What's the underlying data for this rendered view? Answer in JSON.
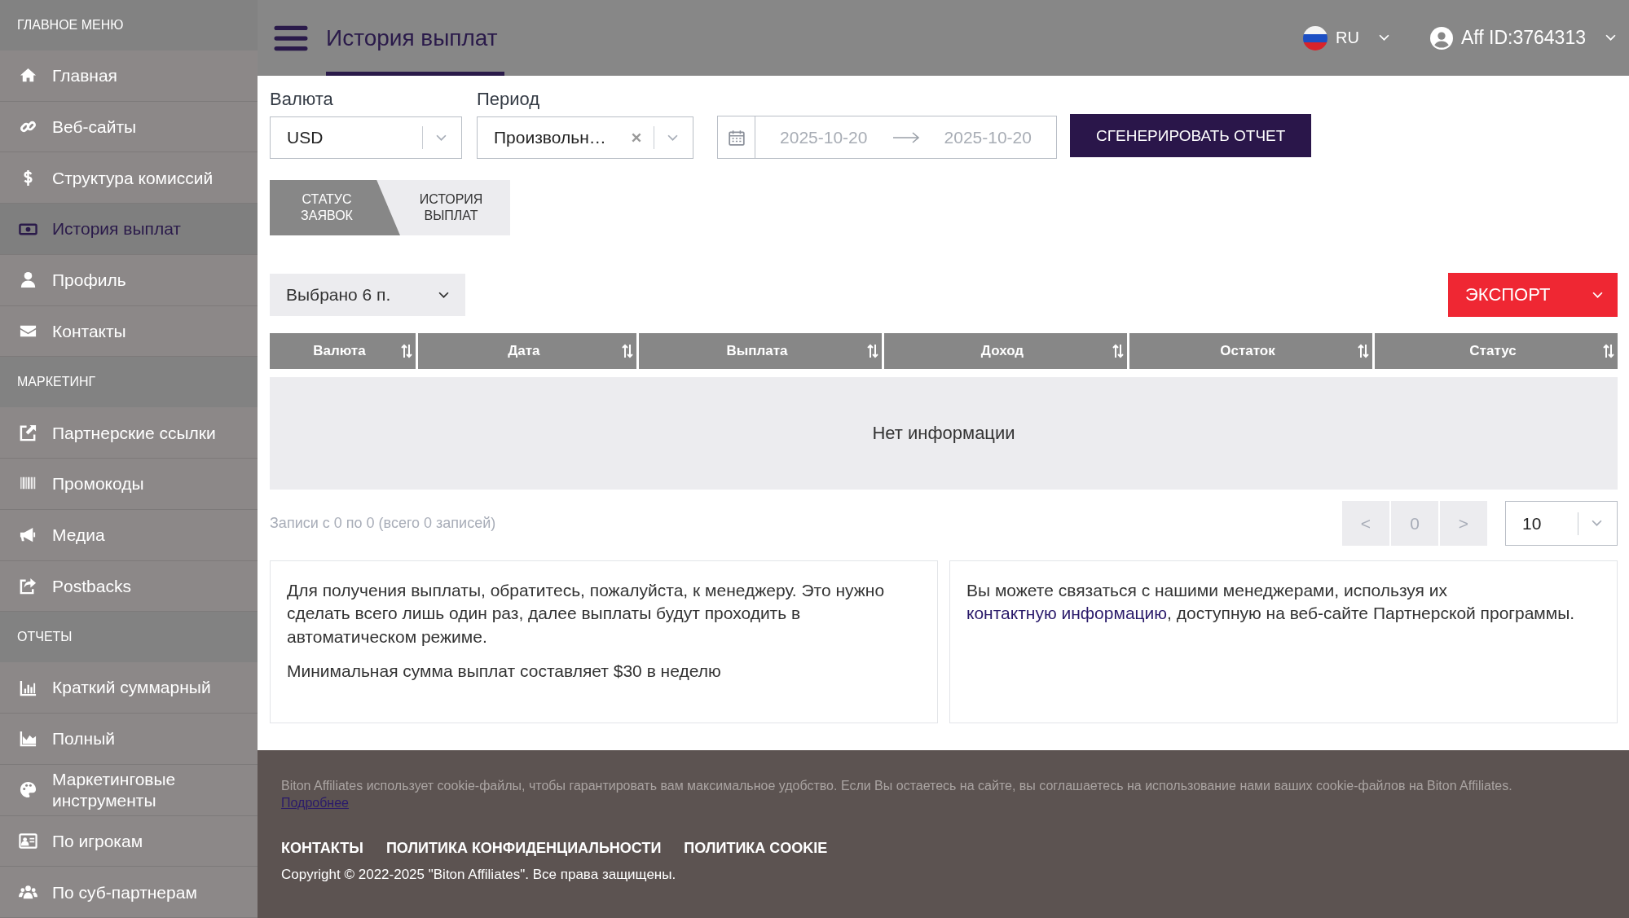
{
  "sidebar": {
    "sections": [
      {
        "title": "ГЛАВНОЕ МЕНЮ",
        "items": [
          {
            "label": "Главная",
            "selected": false
          },
          {
            "label": "Веб-сайты",
            "selected": false
          },
          {
            "label": "Структура комиссий",
            "selected": false
          },
          {
            "label": "История выплат",
            "selected": true
          },
          {
            "label": "Профиль",
            "selected": false
          },
          {
            "label": "Контакты",
            "selected": false
          }
        ]
      },
      {
        "title": "МАРКЕТИНГ",
        "items": [
          {
            "label": "Партнерские ссылки",
            "selected": false
          },
          {
            "label": "Промокоды",
            "selected": false
          },
          {
            "label": "Медиа",
            "selected": false
          },
          {
            "label": "Postbacks",
            "selected": false
          }
        ]
      },
      {
        "title": "ОТЧЕТЫ",
        "items": [
          {
            "label": "Краткий суммарный",
            "selected": false
          },
          {
            "label": "Полный",
            "selected": false
          },
          {
            "label": "Маркетинговые инструменты",
            "selected": false
          },
          {
            "label": "По игрокам",
            "selected": false
          },
          {
            "label": "По суб-партнерам",
            "selected": false
          }
        ]
      }
    ]
  },
  "header": {
    "title": "История выплат",
    "language": "RU",
    "account": "Aff ID:3764313"
  },
  "filters": {
    "currency": {
      "label": "Валюта",
      "value": "USD"
    },
    "period": {
      "label": "Период",
      "value": "Произвольн…"
    },
    "date_range": {
      "start": "2025-10-20",
      "end": "2025-10-20"
    },
    "generate_button": "СГЕНЕРИРОВАТЬ ОТЧЕТ"
  },
  "tabs": [
    {
      "label": "СТАТУС ЗАЯВОК",
      "selected": false
    },
    {
      "label": "ИСТОРИЯ ВЫПЛАТ",
      "selected": true
    }
  ],
  "column_select": "Выбрано 6 п.",
  "export_button": "ЭКСПОРТ",
  "table": {
    "columns": [
      "Валюта",
      "Дата",
      "Выплата",
      "Доход",
      "Остаток",
      "Статус"
    ],
    "empty_message": "Нет информации"
  },
  "records_info": "Записи с 0 по 0 (всего 0 записей)",
  "pagination": {
    "prev": "<",
    "page": "0",
    "next": ">",
    "page_size": "10"
  },
  "info_cards": [
    {
      "paragraphs": [
        {
          "text": "Для получения выплаты, обратитесь, пожалуйста, к менеджеру. Это нужно сделать всего лишь один раз, далее выплаты будут проходить в автоматическом режиме."
        },
        {
          "text": "Минимальная сумма выплат составляет $30 в неделю"
        }
      ]
    },
    {
      "paragraphs": [
        {
          "text": "Вы можете связаться с нашими менеджерами, используя их",
          "link": "контактную информацию",
          "after": ", доступную на веб-сайте Партнерской программы."
        }
      ]
    }
  ],
  "footer": {
    "cookie_notice": "Biton Affiliates использует cookie-файлы, чтобы гарантировать вам максимальное удобство. Если Вы остаетесь на сайте, вы соглашаетесь на использование нами ваших cookie-файлов на Biton Affiliates.",
    "more_link": "Подробнее",
    "links": [
      "КОНТАКТЫ",
      "ПОЛИТИКА КОНФИДЕНЦИАЛЬНОСТИ",
      "ПОЛИТИКА COOKIE"
    ],
    "copyright": "Copyright © 2022-2025 \"Biton Affiliates\". Все права защищены."
  }
}
